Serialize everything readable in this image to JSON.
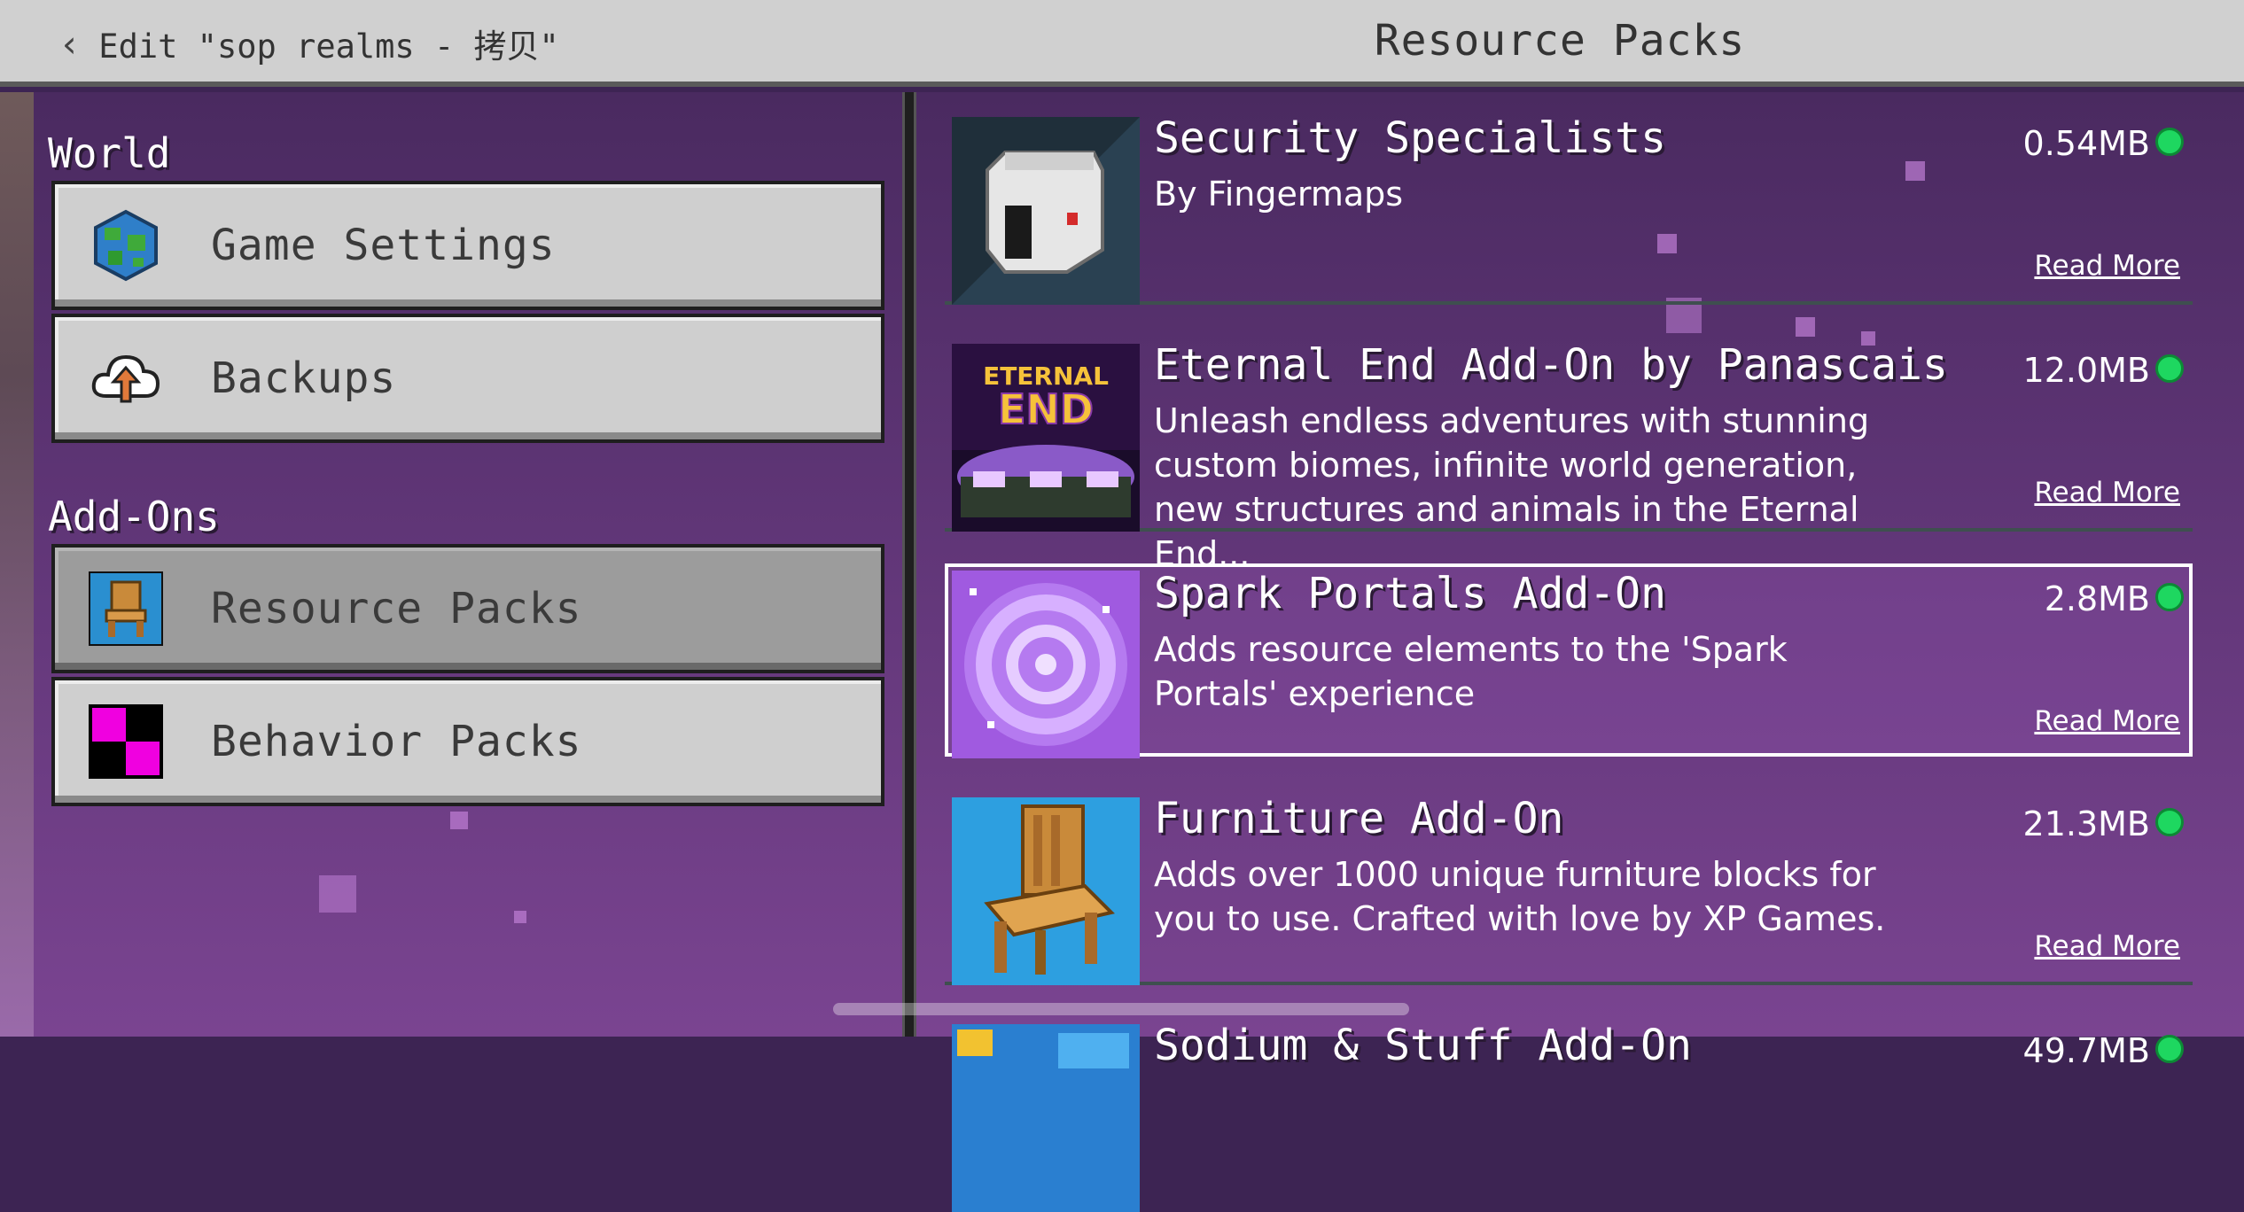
{
  "header": {
    "back_label": "Edit \"sop realms - 拷贝\"",
    "title": "Resource Packs"
  },
  "sidebar": {
    "world_label": "World",
    "addons_label": "Add-Ons",
    "items": [
      {
        "label": "Game Settings"
      },
      {
        "label": "Backups"
      },
      {
        "label": "Resource Packs"
      },
      {
        "label": "Behavior Packs"
      }
    ]
  },
  "packs": [
    {
      "name": "Security Specialists",
      "desc": "By Fingermaps",
      "size": "0.54MB",
      "read_more": "Read More"
    },
    {
      "name": "Eternal End Add-On by Panascais",
      "desc": "Unleash endless adventures with stunning custom biomes, infinite world generation, new structures and animals in the Eternal End...",
      "size": "12.0MB",
      "read_more": "Read More",
      "thumb_text_1": "ETERNAL",
      "thumb_text_2": "END"
    },
    {
      "name": "Spark Portals Add-On",
      "desc": "Adds resource elements to the 'Spark Portals' experience",
      "size": "2.8MB",
      "read_more": "Read More"
    },
    {
      "name": "Furniture Add-On",
      "desc": "Adds over 1000 unique furniture blocks for you to use. Crafted with love by XP Games.",
      "size": "21.3MB",
      "read_more": "Read More"
    },
    {
      "name": "Sodium & Stuff Add-On",
      "size": "49.7MB"
    }
  ],
  "colors": {
    "active_dot": "#1ed760",
    "header_bg": "#d0d0d0",
    "selected_nav": "#9c9c9c"
  }
}
